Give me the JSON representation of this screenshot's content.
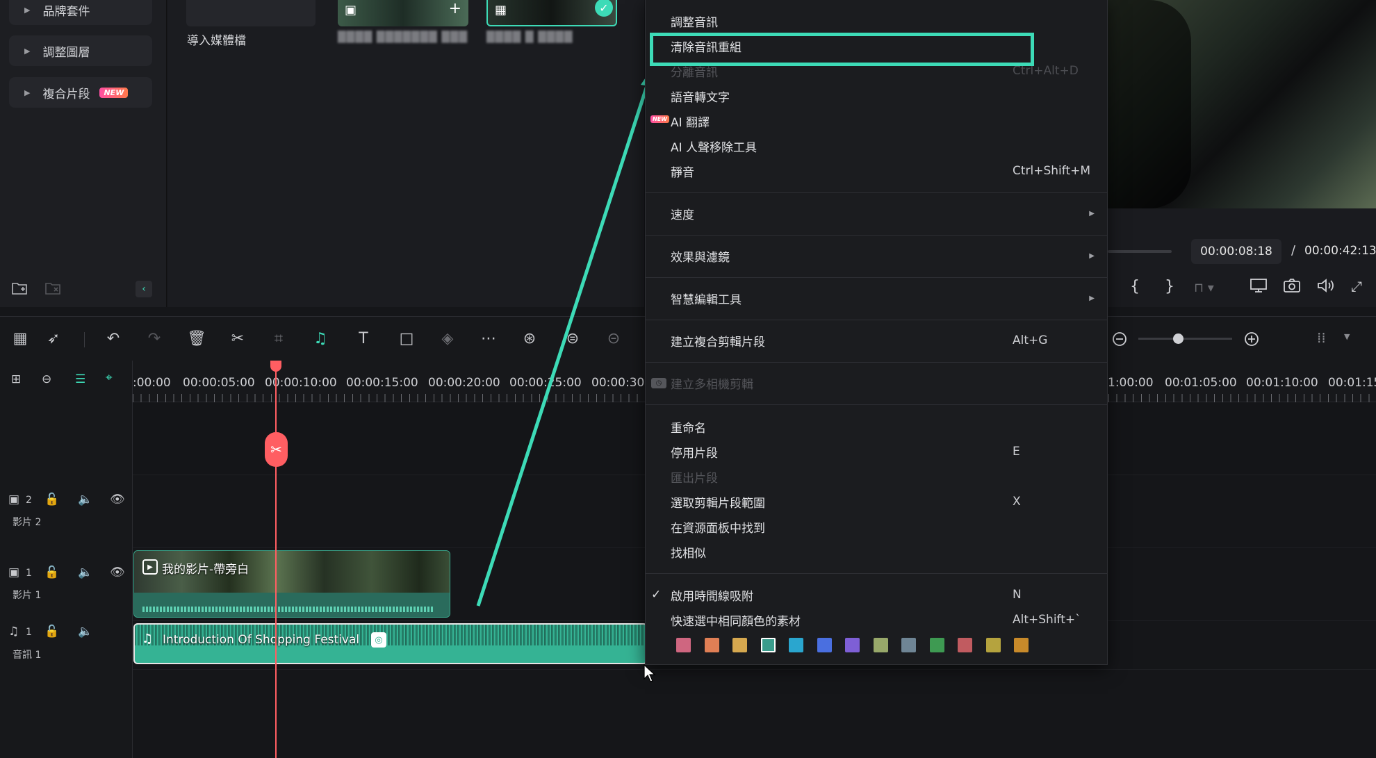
{
  "library": {
    "categories": [
      {
        "label": "品牌套件"
      },
      {
        "label": "調整圖層"
      },
      {
        "label": "複合片段",
        "badge": "NEW"
      }
    ]
  },
  "media": {
    "import_label": "導入媒體檔",
    "items": [
      {
        "label": "████ ███████ ███"
      },
      {
        "label": "████ █ ████"
      }
    ]
  },
  "preview": {
    "current_time": "00:00:08:18",
    "separator": "/",
    "total_time": "00:00:42:13"
  },
  "ruler": {
    "ticks": [
      ":00:00",
      "00:00:05:00",
      "00:00:10:00",
      "00:00:15:00",
      "00:00:20:00",
      "00:00:25:00",
      "00:00:30:"
    ],
    "ticks_right": [
      "1:00:00",
      "00:01:05:00",
      "00:01:10:00",
      "00:01:15"
    ]
  },
  "tracks": {
    "video2": {
      "num": "2",
      "name": "影片 2"
    },
    "video1": {
      "num": "1",
      "name": "影片 1"
    },
    "audio1": {
      "num": "1",
      "name": "音訊 1"
    }
  },
  "clips": {
    "video_title": "我的影片-帶旁白",
    "audio_title": "Introduction Of Shopping Festival"
  },
  "context_menu": {
    "items": [
      {
        "label": "調整音訊",
        "shortcut": ""
      },
      {
        "label": "清除音訊重組",
        "shortcut": ""
      },
      {
        "label": "分離音訊",
        "shortcut": "Ctrl+Alt+D"
      },
      {
        "label": "語音轉文字",
        "shortcut": ""
      },
      {
        "label": "AI 翻譯",
        "shortcut": "",
        "badge": "NEW"
      },
      {
        "label": "AI 人聲移除工具",
        "shortcut": ""
      },
      {
        "label": "靜音",
        "shortcut": "Ctrl+Shift+M"
      },
      {
        "label": "速度",
        "shortcut": ""
      },
      {
        "label": "效果與濾鏡",
        "shortcut": ""
      },
      {
        "label": "智慧編輯工具",
        "shortcut": ""
      },
      {
        "label": "建立複合剪輯片段",
        "shortcut": "Alt+G"
      },
      {
        "label": "建立多相機剪輯",
        "shortcut": ""
      },
      {
        "label": "重命名",
        "shortcut": ""
      },
      {
        "label": "停用片段",
        "shortcut": "E"
      },
      {
        "label": "匯出片段",
        "shortcut": ""
      },
      {
        "label": "選取剪輯片段範圍",
        "shortcut": "X"
      },
      {
        "label": "在資源面板中找到",
        "shortcut": ""
      },
      {
        "label": "找相似",
        "shortcut": ""
      },
      {
        "label": "啟用時間線吸附",
        "shortcut": "N"
      },
      {
        "label": "快速選中相同顏色的素材",
        "shortcut": "Alt+Shift+`"
      }
    ],
    "color_swatches": [
      "#cf6680",
      "#e07f55",
      "#d6a84f",
      "#3a9c8c",
      "#2aa6cf",
      "#4a6fe0",
      "#7e5fd6",
      "#98a86a",
      "#6f8595",
      "#3e9a52",
      "#c15b60",
      "#b5a33e",
      "#c88a2a"
    ]
  }
}
